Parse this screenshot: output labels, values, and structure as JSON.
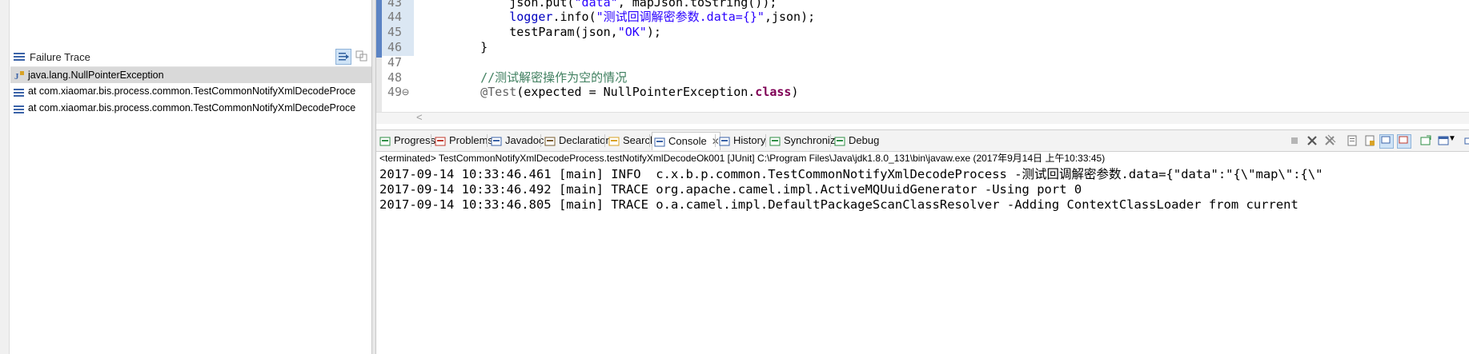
{
  "junit": {
    "failure_trace": {
      "title": "Failure Trace",
      "rows": [
        {
          "text": "java.lang.NullPointerException",
          "icon": "exception-icon",
          "selected": true
        },
        {
          "text": "at com.xiaomar.bis.process.common.TestCommonNotifyXmlDecodeProce",
          "icon": "stack-frame-icon",
          "selected": false
        },
        {
          "text": "at com.xiaomar.bis.process.common.TestCommonNotifyXmlDecodeProce",
          "icon": "stack-frame-icon",
          "selected": false
        }
      ]
    }
  },
  "editor": {
    "lines": [
      {
        "num": "43",
        "segments": [
          {
            "t": "        json.put(",
            "c": ""
          },
          {
            "t": "\"data\"",
            "c": "str"
          },
          {
            "t": ", mapJson.toString());",
            "c": ""
          }
        ]
      },
      {
        "num": "44",
        "segments": [
          {
            "t": "        ",
            "c": ""
          },
          {
            "t": "logger",
            "c": "fld"
          },
          {
            "t": ".info(",
            "c": ""
          },
          {
            "t": "\"测试回调解密参数.data={}\"",
            "c": "str"
          },
          {
            "t": ",json);",
            "c": ""
          }
        ]
      },
      {
        "num": "45",
        "segments": [
          {
            "t": "        testParam(json,",
            "c": ""
          },
          {
            "t": "\"OK\"",
            "c": "str"
          },
          {
            "t": ");",
            "c": ""
          }
        ]
      },
      {
        "num": "46",
        "segments": [
          {
            "t": "    }",
            "c": ""
          }
        ]
      },
      {
        "num": "47",
        "segments": [
          {
            "t": "",
            "c": ""
          }
        ]
      },
      {
        "num": "48",
        "segments": [
          {
            "t": "    ",
            "c": ""
          },
          {
            "t": "//测试解密操作为空的情况",
            "c": "com"
          }
        ]
      },
      {
        "num": "49⊖",
        "segments": [
          {
            "t": "    ",
            "c": ""
          },
          {
            "t": "@Test",
            "c": "ann"
          },
          {
            "t": "(expected = NullPointerException.",
            "c": ""
          },
          {
            "t": "class",
            "c": "key"
          },
          {
            "t": ")",
            "c": ""
          }
        ]
      }
    ],
    "scroll_arrow": "<"
  },
  "tabs": [
    {
      "label": "Progress",
      "icon": "progress-icon",
      "active": false
    },
    {
      "label": "Problems",
      "icon": "problems-icon",
      "active": false
    },
    {
      "label": "Javadoc",
      "icon": "javadoc-icon",
      "active": false
    },
    {
      "label": "Declaration",
      "icon": "declaration-icon",
      "active": false
    },
    {
      "label": "Search",
      "icon": "search-icon",
      "active": false
    },
    {
      "label": "Console",
      "icon": "console-icon",
      "active": true,
      "close": "✕"
    },
    {
      "label": "History",
      "icon": "history-icon",
      "active": false
    },
    {
      "label": "Synchronize",
      "icon": "synchronize-icon",
      "active": false
    },
    {
      "label": "Debug",
      "icon": "debug-icon",
      "active": false
    }
  ],
  "console": {
    "header": "<terminated> TestCommonNotifyXmlDecodeProcess.testNotifyXmlDecodeOk001 [JUnit] C:\\Program Files\\Java\\jdk1.8.0_131\\bin\\javaw.exe (2017年9月14日 上午10:33:45)",
    "lines": [
      "2017-09-14 10:33:46.461 [main] INFO  c.x.b.p.common.TestCommonNotifyXmlDecodeProcess -测试回调解密参数.data={\"data\":\"{\\\"map\\\":{\\\"",
      "2017-09-14 10:33:46.492 [main] TRACE org.apache.camel.impl.ActiveMQUuidGenerator -Using port 0",
      "2017-09-14 10:33:46.805 [main] TRACE o.a.camel.impl.DefaultPackageScanClassResolver -Adding ContextClassLoader from current"
    ]
  },
  "colors": {
    "keyword": "#7f0055",
    "string": "#2a00ff",
    "comment": "#3f7f5f",
    "annotation": "#646464",
    "field": "#0000c0",
    "selected_row": "#d9d9d9"
  }
}
